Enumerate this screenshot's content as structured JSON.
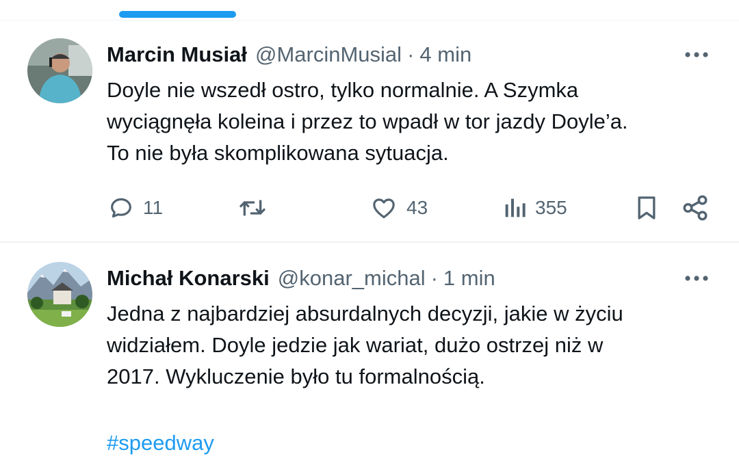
{
  "tweets": [
    {
      "author_name": "Marcin Musiał",
      "handle": "@MarcinMusial",
      "separator": "·",
      "time": "4 min",
      "text_lines": [
        "Doyle nie wszedł ostro, tylko normalnie. A Szymka",
        "wyciągnęła koleina i przez to wpadł w tor jazdy Doyle’a.",
        "To nie była skomplikowana sytuacja."
      ],
      "replies": "11",
      "retweets": "",
      "likes": "43",
      "views": "355"
    },
    {
      "author_name": "Michał Konarski",
      "handle": "@konar_michal",
      "separator": "·",
      "time": "1 min",
      "text_lines": [
        "Jedna z najbardziej absurdalnych decyzji, jakie w życiu",
        "widziałem. Doyle jedzie jak wariat, dużo ostrzej niż w",
        "2017. Wykluczenie było tu formalnością."
      ],
      "hashtag": "#speedway"
    }
  ],
  "colors": {
    "accent": "#1d9bf0",
    "text": "#0f1419",
    "muted": "#536471",
    "divider": "#eff3f4"
  },
  "icons": [
    "more-icon",
    "reply-icon",
    "retweet-icon",
    "like-icon",
    "views-icon",
    "bookmark-icon",
    "share-icon"
  ]
}
